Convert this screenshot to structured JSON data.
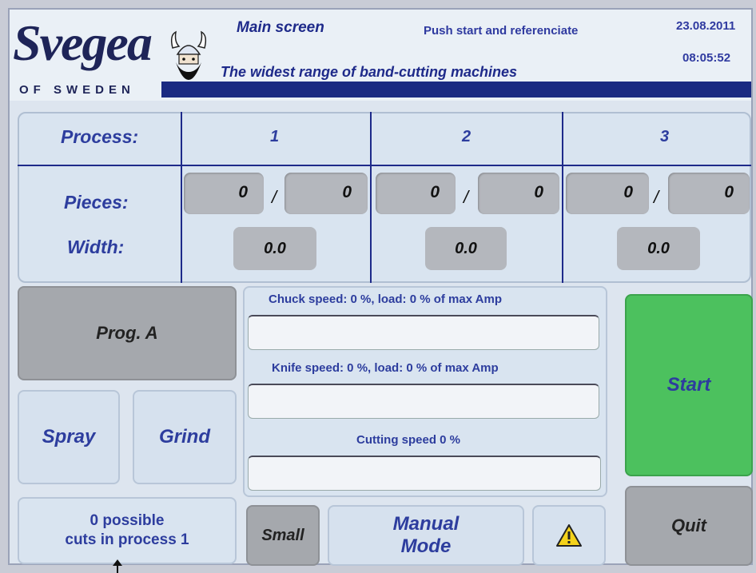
{
  "header": {
    "logo_text": "Svegea",
    "logo_sub": "OF SWEDEN",
    "screen_title": "Main screen",
    "status_message": "Push start and referenciate",
    "date": "23.08.2011",
    "time": "08:05:52",
    "tagline": "The widest range of band-cutting machines"
  },
  "process_table": {
    "process_label": "Process:",
    "pieces_label": "Pieces:",
    "width_label": "Width:",
    "processes": [
      {
        "number": "1",
        "pieces_done": "0",
        "pieces_total": "0",
        "width": "0.0"
      },
      {
        "number": "2",
        "pieces_done": "0",
        "pieces_total": "0",
        "width": "0.0"
      },
      {
        "number": "3",
        "pieces_done": "0",
        "pieces_total": "0",
        "width": "0.0"
      }
    ],
    "separator": "/"
  },
  "controls": {
    "program_label": "Prog. A",
    "spray_label": "Spray",
    "grind_label": "Grind",
    "start_label": "Start",
    "quit_label": "Quit",
    "small_label": "Small",
    "manual_mode_line1": "Manual",
    "manual_mode_line2": "Mode",
    "warning_icon": "warning-triangle-icon"
  },
  "speeds": {
    "chuck_label": "Chuck speed:  0 %, load: 0 % of max Amp",
    "knife_label": "Knife speed:  0 %, load: 0 % of max Amp",
    "cutting_label": "Cutting speed  0 %",
    "chuck_level": 0,
    "knife_level": 0,
    "cutting_level": 0
  },
  "info": {
    "possible_line1": "0 possible",
    "possible_line2": "cuts in process 1"
  },
  "colors": {
    "accent_blue": "#1a2a82",
    "label_blue": "#2d3d9e",
    "start_green": "#4cc15e",
    "gray_button": "#a5a8ad",
    "panel_bg": "#d9e4f0"
  }
}
